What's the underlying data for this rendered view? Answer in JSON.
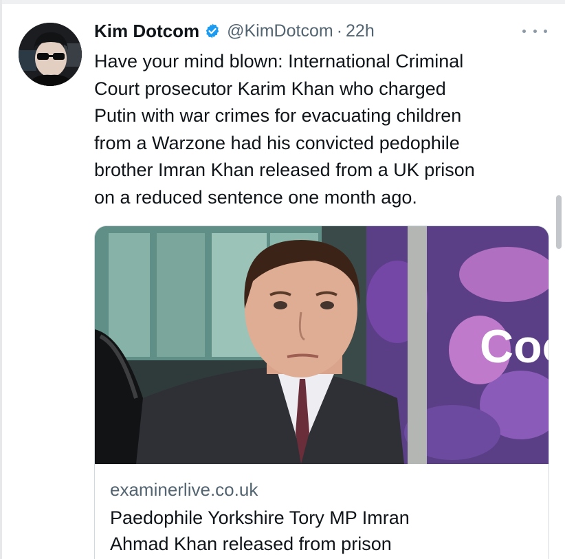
{
  "tweet": {
    "author_name": "Kim Dotcom",
    "handle": "@KimDotcom",
    "separator": "·",
    "time": "22h",
    "text": "Have your mind blown: International Criminal\nCourt prosecutor Karim Khan who charged\nPutin with war crimes for evacuating children\nfrom a Warzone had his convicted pedophile\nbrother Imran Khan released from a UK prison\non a reduced sentence one month ago."
  },
  "card": {
    "domain": "examinerlive.co.uk",
    "title": "Paedophile Yorkshire Tory MP Imran\nAhmad Khan released from prison",
    "photo_sign_text": "Coo"
  },
  "icons": {
    "verified": "verified-badge-icon",
    "more": "more-options-icon"
  },
  "colors": {
    "verified_blue": "#1d9bf0",
    "secondary_text": "#536471",
    "primary_text": "#0f1419",
    "card_border": "#cfd9de"
  }
}
